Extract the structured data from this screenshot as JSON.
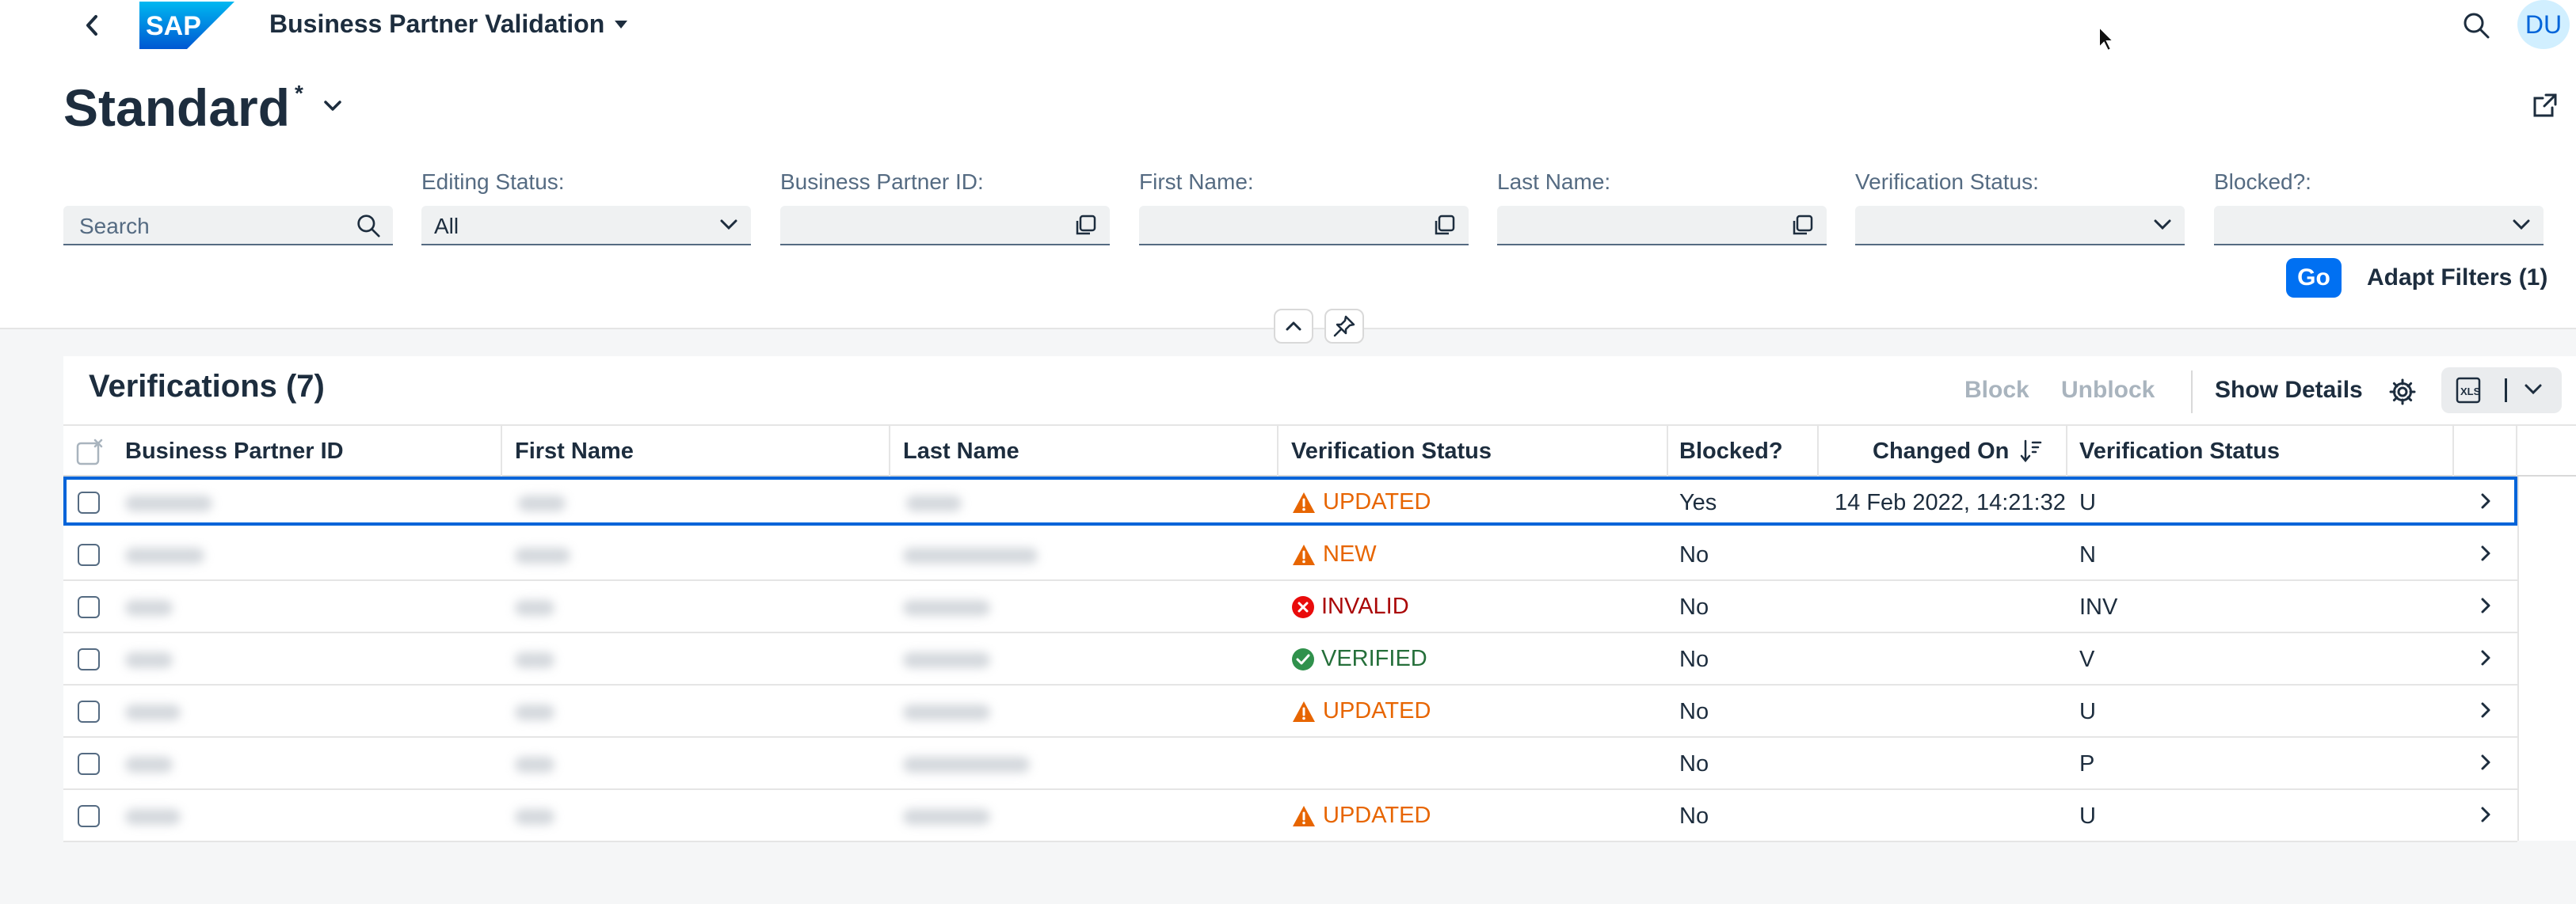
{
  "shell": {
    "app_title": "Business Partner Validation",
    "logo_text": "SAP",
    "avatar_initials": "DU"
  },
  "header": {
    "variant_name": "Standard",
    "variant_modified_marker": "*"
  },
  "filters": {
    "search_placeholder": "Search",
    "editing_status_label": "Editing Status:",
    "editing_status_value": "All",
    "bp_id_label": "Business Partner ID:",
    "first_name_label": "First Name:",
    "last_name_label": "Last Name:",
    "verification_status_label": "Verification Status:",
    "blocked_label": "Blocked?:",
    "go_label": "Go",
    "adapt_label": "Adapt Filters (1)"
  },
  "table": {
    "title": "Verifications (7)",
    "toolbar": {
      "block": "Block",
      "unblock": "Unblock",
      "show_details": "Show Details",
      "export_label": "XLS"
    },
    "columns": [
      "Business Partner ID",
      "First Name",
      "Last Name",
      "Verification Status",
      "Blocked?",
      "Changed On",
      "Verification Status"
    ],
    "rows": [
      {
        "status": "UPDATED",
        "status_kind": "warning",
        "blocked": "Yes",
        "changed_on": "14 Feb 2022, 14:21:32",
        "code": "U"
      },
      {
        "status": "NEW",
        "status_kind": "warning",
        "blocked": "No",
        "changed_on": "",
        "code": "N"
      },
      {
        "status": "INVALID",
        "status_kind": "error",
        "blocked": "No",
        "changed_on": "",
        "code": "INV"
      },
      {
        "status": "VERIFIED",
        "status_kind": "success",
        "blocked": "No",
        "changed_on": "",
        "code": "V"
      },
      {
        "status": "UPDATED",
        "status_kind": "warning",
        "blocked": "No",
        "changed_on": "",
        "code": "U"
      },
      {
        "status": "",
        "status_kind": "none",
        "blocked": "No",
        "changed_on": "",
        "code": "P"
      },
      {
        "status": "UPDATED",
        "status_kind": "warning",
        "blocked": "No",
        "changed_on": "",
        "code": "U"
      }
    ]
  },
  "colors": {
    "brand": "#0070f2",
    "warning": "#e76500",
    "error": "#aa0808",
    "success": "#256f3a",
    "selected_row_border": "#0064d9"
  }
}
